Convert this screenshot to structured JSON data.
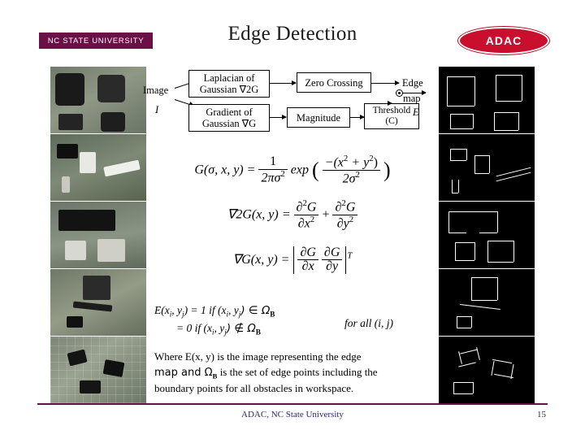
{
  "header": {
    "university_badge": "NC STATE  UNIVERSITY",
    "title": "Edge Detection",
    "logo_text": "ADAC"
  },
  "diagram": {
    "input_label": "Image",
    "input_sublabel": "I",
    "boxes": [
      {
        "line1": "Laplacian of",
        "line2": "Gaussian ∇2G"
      },
      {
        "line1": "Zero Crossing",
        "line2": ""
      },
      {
        "line1": "Gradient of",
        "line2": "Gaussian ∇G"
      },
      {
        "line1": "Magnitude",
        "line2": ""
      },
      {
        "line1": "Threshold",
        "line2": "(C)"
      }
    ],
    "output_line1": "Edge",
    "output_line2": "map",
    "output_line3": "E"
  },
  "equations": {
    "eq1_lhs": "G(σ, x, y) =",
    "eq1_num": "1",
    "eq1_den": "2πσ",
    "eq1_den_sup": "2",
    "eq1_exp": "exp",
    "eq1_frac_num": "−(x",
    "eq1_frac_num2": "+ y",
    "eq1_frac_den": "2σ",
    "eq2_lhs": "∇2G(x, y) =",
    "eq2_t1_num": "∂",
    "eq2_t1_den": "∂x",
    "eq2_t2_num": "∂",
    "eq2_t2_den": "∂y",
    "eq3_lhs": "∇G(x, y) =",
    "eq3_t1_num": "∂G",
    "eq3_t1_den": "∂x",
    "eq3_t2_num": "∂G",
    "eq3_t2_den": "∂y",
    "eq3_sup": "T"
  },
  "edge_map_definition": {
    "line1_a": "E(x",
    "line1_sub1": "i",
    "line1_b": ", y",
    "line1_sub2": "j",
    "line1_c": ") = 1  if  (x",
    "line1_sub3": "i",
    "line1_d": ", y",
    "line1_sub4": "j",
    "line1_e": ") ∈ Ω",
    "line1_sub5": "B",
    "line2_a": "= 0  if (x",
    "line2_sub1": "i",
    "line2_b": ", y",
    "line2_sub2": "j",
    "line2_c": ") ∉ Ω",
    "line2_sub3": "B",
    "for_all": "for all (i, j)"
  },
  "where_text": {
    "line1": "Where E(x, y) is the image representing the edge",
    "line2_a": "map and Ω",
    "line2_sub": "B",
    "line2_b": " is the set of edge points  including the",
    "line3": "boundary points for all obstacles in workspace."
  },
  "footer": {
    "center": "ADAC, NC State University",
    "page_number": "15"
  },
  "colors": {
    "accent": "#6b0f47",
    "logo": "#c8102e",
    "footer_text": "#2a2a6a",
    "edge_bg": "#000000"
  }
}
